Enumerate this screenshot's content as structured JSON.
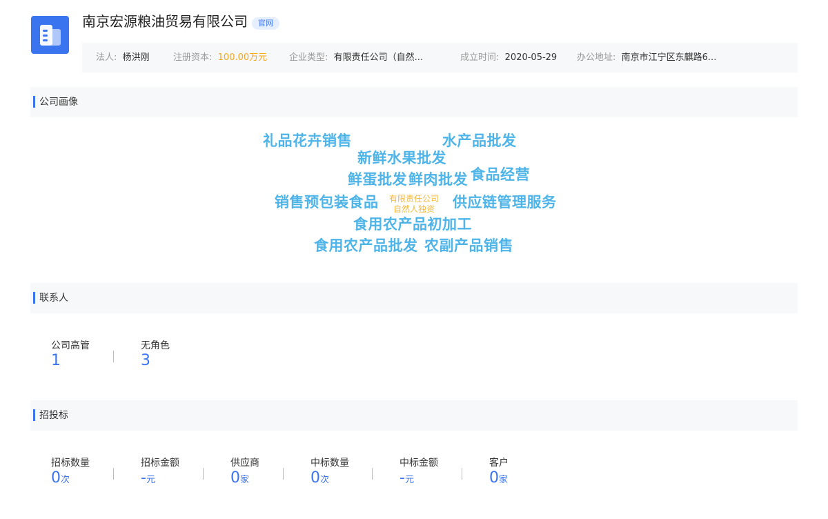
{
  "header": {
    "company_name": "南京宏源粮油贸易有限公司",
    "official_badge": "官网",
    "logo_icon": "building-icon",
    "brand_color": "#3b74ef",
    "info": [
      {
        "label": "法人:",
        "value": "杨洪刚"
      },
      {
        "label": "注册资本:",
        "value": "100.00万元"
      },
      {
        "label": "企业类型:",
        "value": "有限责任公司（自然..."
      },
      {
        "label": "成立时间:",
        "value": "2020-05-29"
      },
      {
        "label": "办公地址:",
        "value": "南京市江宁区东麒路6..."
      }
    ]
  },
  "portrait": {
    "title": "公司画像",
    "tags": [
      "礼品花卉销售",
      "水产品批发",
      "新鲜水果批发",
      "鲜蛋批发",
      "鲜肉批发",
      "食品经营",
      "销售预包装食品",
      "有限责任公司",
      "自然人独资",
      "供应链管理服务",
      "食用农产品初加工",
      "食用农产品批发",
      "农副产品销售"
    ]
  },
  "contacts": {
    "title": "联系人",
    "stats": [
      {
        "label": "公司高管",
        "value": "1"
      },
      {
        "label": "无角色",
        "value": "3"
      }
    ]
  },
  "bidding": {
    "title": "招投标",
    "stats": [
      {
        "label": "招标数量",
        "value": "0",
        "unit": "次"
      },
      {
        "label": "招标金额",
        "value": "-",
        "unit": "元"
      },
      {
        "label": "供应商",
        "value": "0",
        "unit": "家"
      },
      {
        "label": "中标数量",
        "value": "0",
        "unit": "次"
      },
      {
        "label": "中标金额",
        "value": "-",
        "unit": "元"
      },
      {
        "label": "客户",
        "value": "0",
        "unit": "家"
      }
    ]
  }
}
